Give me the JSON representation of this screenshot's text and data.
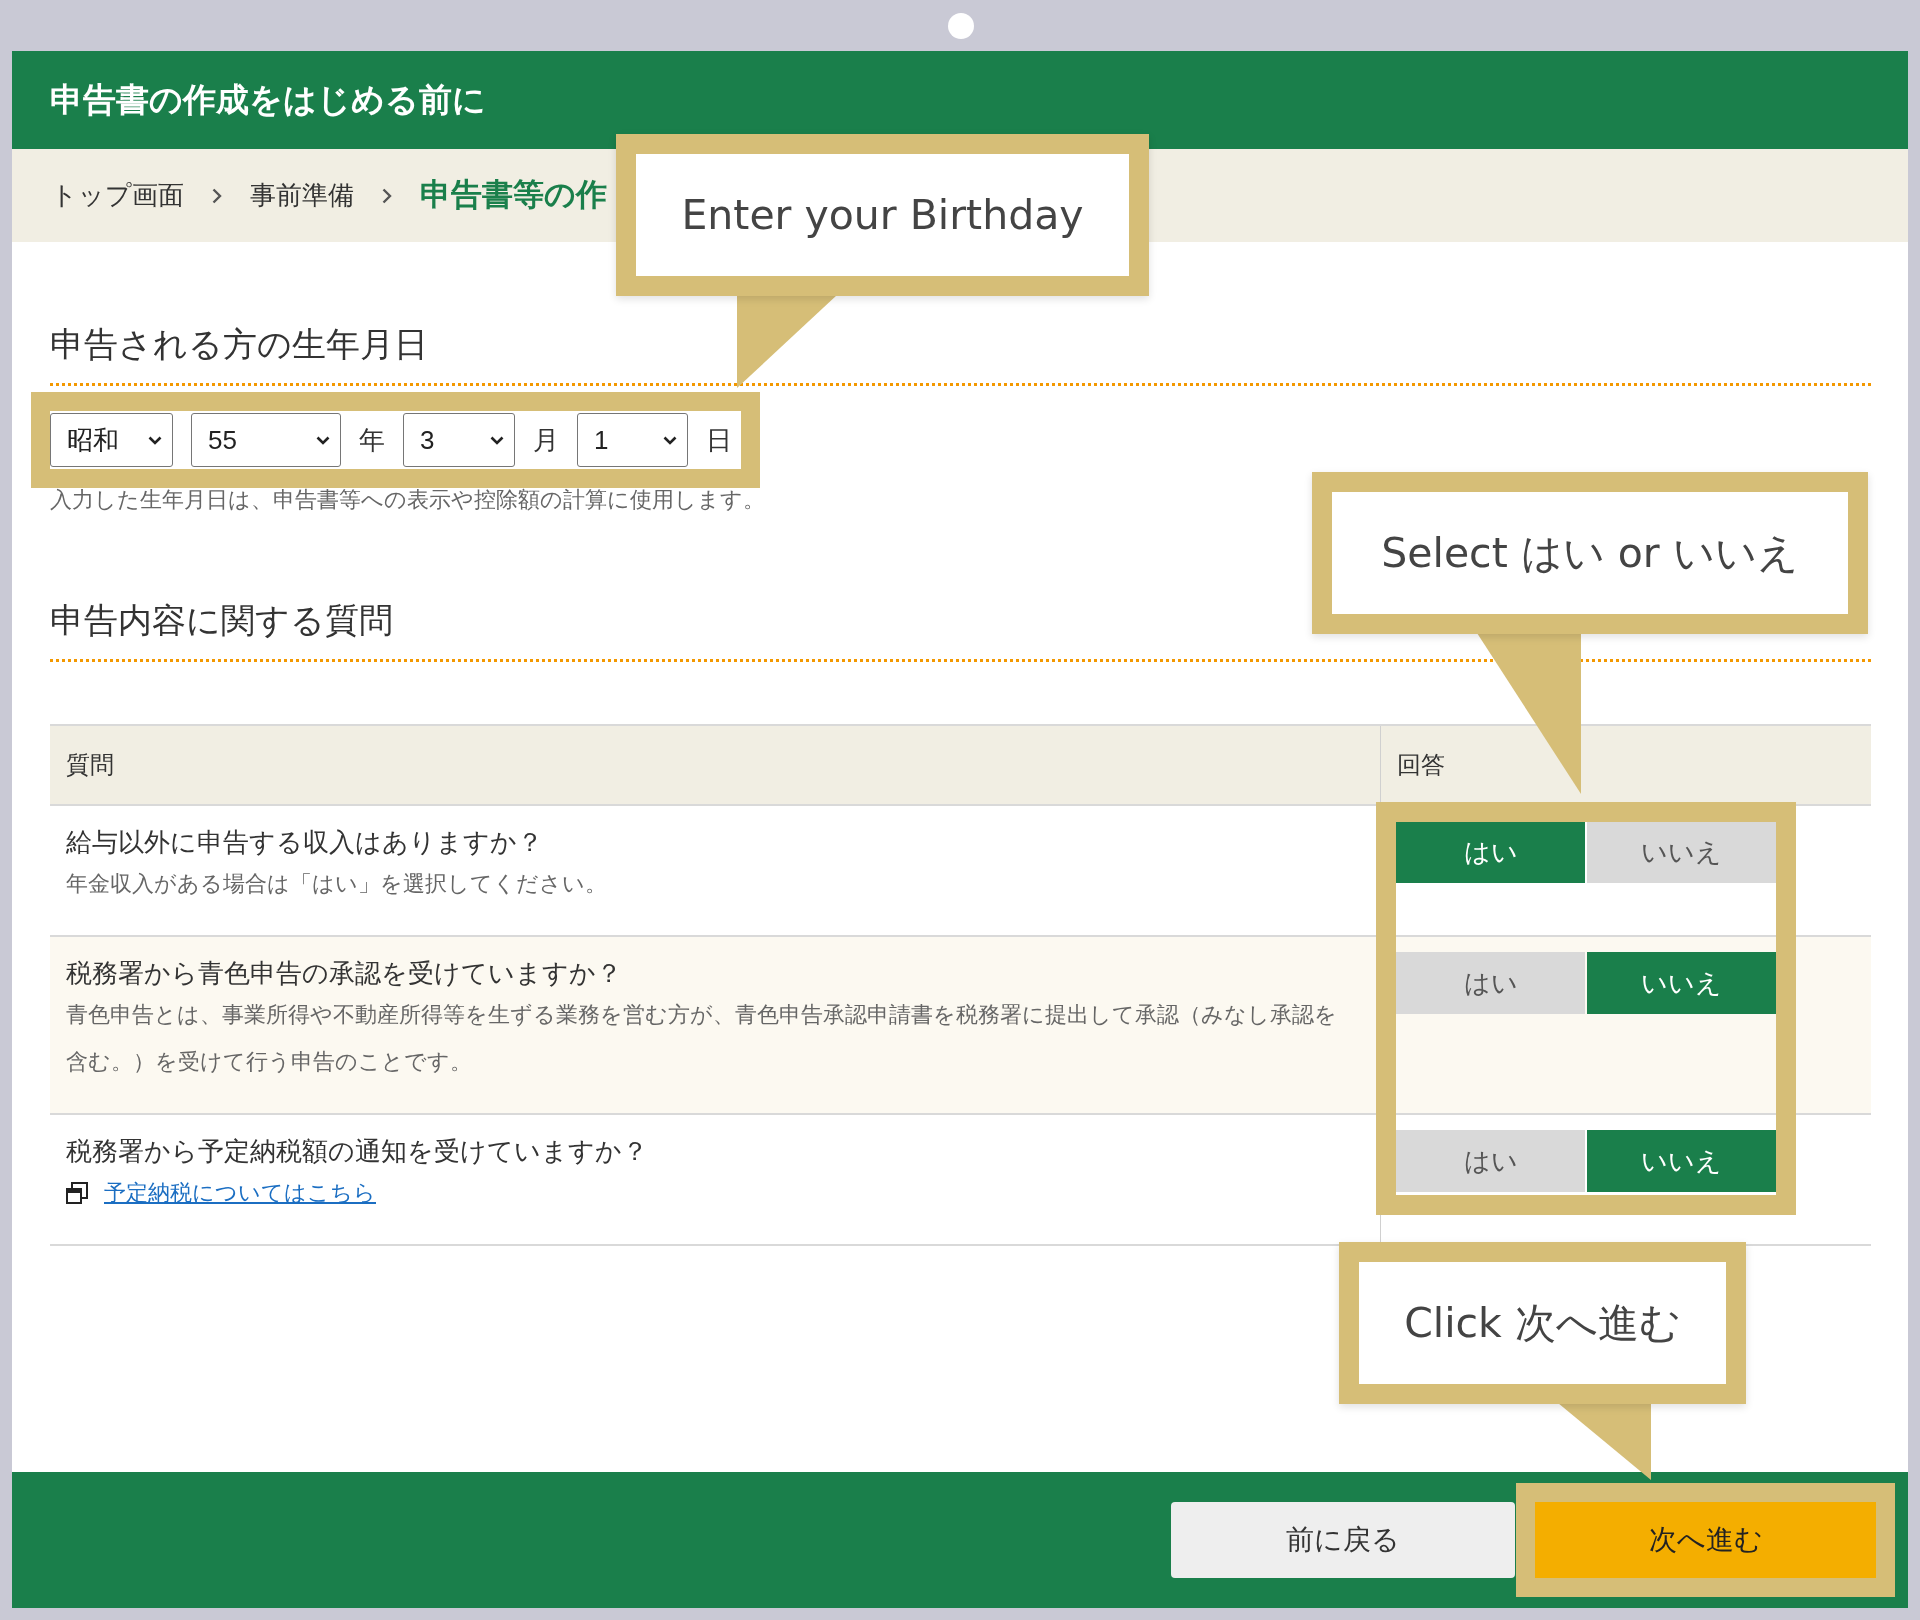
{
  "header": {
    "title": "申告書の作成をはじめる前に"
  },
  "breadcrumb": [
    {
      "label": "トップ画面",
      "current": false
    },
    {
      "label": "事前準備",
      "current": false
    },
    {
      "label": "申告書等の作",
      "current": true
    }
  ],
  "birthday": {
    "title": "申告される方の生年月日",
    "highlighted": true,
    "fields": [
      {
        "value": "昭和"
      },
      {
        "value": "55",
        "unit": "年"
      },
      {
        "value": "3",
        "unit": "月"
      },
      {
        "value": "1",
        "unit": "日"
      }
    ],
    "note": "入力した生年月日は、申告書等への表示や控除額の計算に使用します。"
  },
  "questions": {
    "title": "申告内容に関する質問",
    "highlighted": true,
    "columns": [
      "質問",
      "回答"
    ],
    "rows": [
      {
        "question": "給与以外に申告する収入はありますか？",
        "note": "年金収入がある場合は「はい」を選択してください。",
        "answers": [
          {
            "label": "はい",
            "selected": true
          },
          {
            "label": "いいえ",
            "selected": false
          }
        ]
      },
      {
        "question": "税務署から青色申告の承認を受けていますか？",
        "note": "青色申告とは、事業所得や不動産所得等を生ずる業務を営む方が、青色申告承認申請書を税務署に提出して承認（みなし承認を含む。）を受けて行う申告のことです。",
        "answers": [
          {
            "label": "はい",
            "selected": false
          },
          {
            "label": "いいえ",
            "selected": true
          }
        ]
      },
      {
        "question": "税務署から予定納税額の通知を受けていますか？",
        "link": "予定納税についてはこちら",
        "answers": [
          {
            "label": "はい",
            "selected": false
          },
          {
            "label": "いいえ",
            "selected": true
          }
        ]
      }
    ]
  },
  "footer": {
    "buttons": [
      {
        "label": "前に戻る",
        "kind": "secondary",
        "highlighted": false
      },
      {
        "label": "次へ進む",
        "kind": "primary",
        "highlighted": true
      }
    ]
  },
  "annotations": [
    {
      "text": "Enter your Birthday"
    },
    {
      "text": "Select はい or いいえ"
    },
    {
      "text": "Click 次へ進む"
    }
  ]
}
